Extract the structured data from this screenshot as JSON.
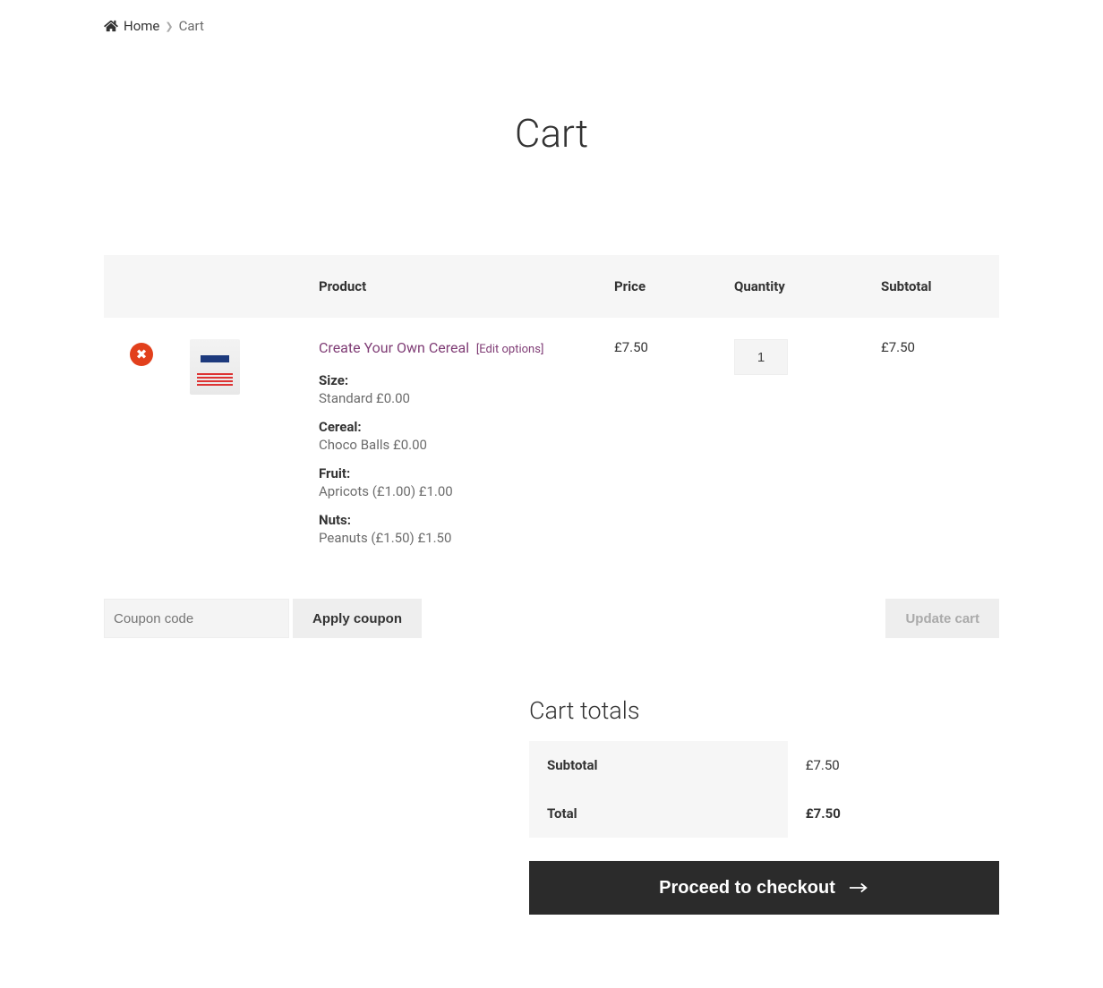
{
  "breadcrumb": {
    "home": "Home",
    "current": "Cart"
  },
  "title": "Cart",
  "headers": {
    "product": "Product",
    "price": "Price",
    "quantity": "Quantity",
    "subtotal": "Subtotal"
  },
  "item": {
    "name": "Create Your Own Cereal",
    "edit": "[Edit options]",
    "price": "£7.50",
    "quantity": "1",
    "subtotal": "£7.50",
    "variations": {
      "size_label": "Size:",
      "size_value": "Standard £0.00",
      "cereal_label": "Cereal:",
      "cereal_value": "Choco Balls £0.00",
      "fruit_label": "Fruit:",
      "fruit_value": "Apricots (£1.00) £1.00",
      "nuts_label": "Nuts:",
      "nuts_value": "Peanuts (£1.50) £1.50"
    }
  },
  "coupon": {
    "placeholder": "Coupon code",
    "apply": "Apply coupon"
  },
  "update_cart": "Update cart",
  "totals": {
    "heading": "Cart totals",
    "subtotal_label": "Subtotal",
    "subtotal_value": "£7.50",
    "total_label": "Total",
    "total_value": "£7.50"
  },
  "checkout": "Proceed to checkout"
}
